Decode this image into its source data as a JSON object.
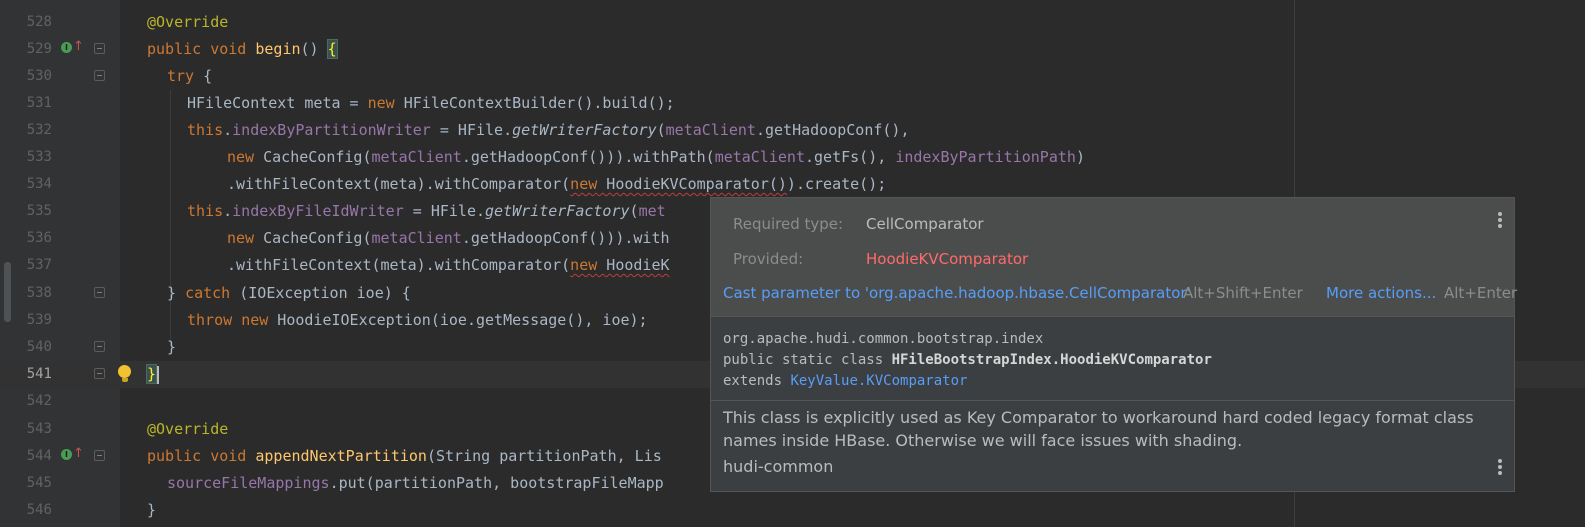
{
  "lines": [
    {
      "number": "528"
    },
    {
      "number": "529"
    },
    {
      "number": "530"
    },
    {
      "number": "531"
    },
    {
      "number": "532"
    },
    {
      "number": "533"
    },
    {
      "number": "534"
    },
    {
      "number": "535"
    },
    {
      "number": "536"
    },
    {
      "number": "537"
    },
    {
      "number": "538"
    },
    {
      "number": "539"
    },
    {
      "number": "540"
    },
    {
      "number": "541"
    },
    {
      "number": "542"
    },
    {
      "number": "543"
    },
    {
      "number": "544"
    },
    {
      "number": "545"
    },
    {
      "number": "546"
    }
  ],
  "code": {
    "l528": {
      "a": "@Override"
    },
    "l529": {
      "a": "public",
      "b": " ",
      "c": "void",
      "d": " ",
      "e": "begin",
      "f": "() ",
      "g": "{"
    },
    "l530": {
      "a": "try",
      "b": " {"
    },
    "l531": {
      "a": "HFileContext meta = ",
      "b": "new",
      "c": " HFileContextBuilder().build();"
    },
    "l532": {
      "a": "this",
      "b": ".",
      "c": "indexByPartitionWriter",
      "d": " = HFile.",
      "e": "getWriterFactory",
      "f": "(",
      "g": "metaClient",
      "h": ".getHadoopConf(),"
    },
    "l533": {
      "a": "new",
      "b": " CacheConfig(",
      "c": "metaClient",
      "d": ".getHadoopConf())).withPath(",
      "e": "metaClient",
      "f": ".getFs(), ",
      "g": "indexByPartitionPath",
      "h": ")"
    },
    "l534": {
      "a": ".withFileContext(meta).withComparator(",
      "b": "new",
      "c": " HoodieKVComparator()",
      "d": ").create();"
    },
    "l535": {
      "a": "this",
      "b": ".",
      "c": "indexByFileIdWriter",
      "d": " = HFile.",
      "e": "getWriterFactory",
      "f": "(",
      "g": "met"
    },
    "l536": {
      "a": "new",
      "b": " CacheConfig(",
      "c": "metaClient",
      "d": ".getHadoopConf())).with"
    },
    "l537": {
      "a": ".withFileContext(meta).withComparator(",
      "b": "new",
      "c": " HoodieK"
    },
    "l538": {
      "a": "} ",
      "b": "catch",
      "c": " (IOException ioe) {"
    },
    "l539": {
      "a": "throw",
      "b": " ",
      "c": "new",
      "d": " HoodieIOException(ioe.getMessage(), ioe);"
    },
    "l540": {
      "a": "}"
    },
    "l541": {
      "a": "}"
    },
    "l543": {
      "a": "@Override"
    },
    "l544": {
      "a": "public",
      "b": " ",
      "c": "void",
      "d": " ",
      "e": "appendNextPartition",
      "f": "(String partitionPath, Lis"
    },
    "l545": {
      "a": "sourceFileMappings",
      "b": ".put(partitionPath, bootstrapFileMapp"
    },
    "l546": {
      "a": "}"
    }
  },
  "gutter_marks": {
    "implements": "I",
    "override_arrow": "↑"
  },
  "tooltip": {
    "required_label": "Required type:",
    "required_value": "CellComparator",
    "provided_label": "Provided:",
    "provided_value": "HoodieKVComparator",
    "action_cast": "Cast parameter to 'org.apache.hadoop.hbase.CellComparator'",
    "action_cast_shortcut": "Alt+Shift+Enter",
    "action_more": "More actions...",
    "action_more_shortcut": "Alt+Enter",
    "doc_package": "org.apache.hudi.common.bootstrap.index",
    "doc_decl_prefix": "public static class ",
    "doc_decl_name": "HFileBootstrapIndex.HoodieKVComparator",
    "doc_extends": "extends ",
    "doc_extends_link": "KeyValue.KVComparator",
    "doc_description": "This class is explicitly used as Key Comparator to workaround hard coded legacy format class names inside HBase. Otherwise we will face issues with shading.",
    "doc_module": "hudi-common"
  },
  "colors": {
    "error": "#ff6b68",
    "link": "#589df6",
    "keyword": "#cc7832",
    "field": "#9876aa",
    "method": "#ffc66d",
    "annotation": "#bbb529"
  }
}
